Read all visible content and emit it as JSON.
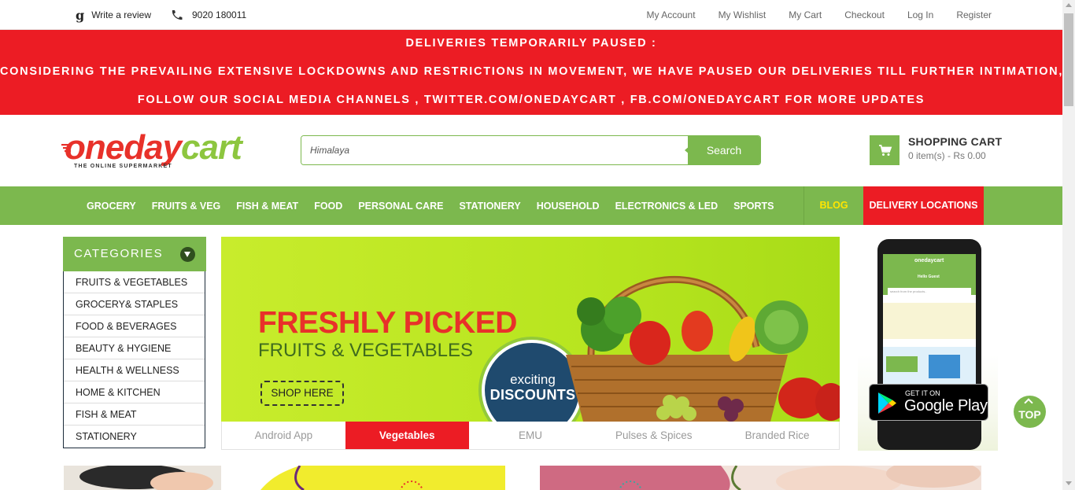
{
  "topbar": {
    "review_label": "Write a review",
    "phone": "9020 180011",
    "links": [
      "My Account",
      "My Wishlist",
      "My Cart",
      "Checkout",
      "Log In",
      "Register"
    ]
  },
  "notice": {
    "line1": "DELIVERIES TEMPORARILY PAUSED :",
    "line2": "CONSIDERING THE PREVAILING EXTENSIVE LOCKDOWNS AND RESTRICTIONS IN MOVEMENT, WE HAVE PAUSED OUR DELIVERIES TILL FURTHER INTIMATION, PLEASE",
    "line3": "FOLLOW OUR SOCIAL MEDIA CHANNELS , TWITTER.COM/ONEDAYCART , FB.COM/ONEDAYCART FOR MORE UPDATES"
  },
  "logo": {
    "part1": "oneday",
    "part2": "cart",
    "tagline": "THE ONLINE SUPERMARKET"
  },
  "search": {
    "value": "Himalaya",
    "button_label": "Search"
  },
  "cart": {
    "title": "SHOPPING CART",
    "summary": "0 item(s) - Rs 0.00"
  },
  "nav": {
    "items": [
      "GROCERY",
      "FRUITS & VEG",
      "FISH & MEAT",
      "FOOD",
      "PERSONAL CARE",
      "STATIONERY",
      "HOUSEHOLD",
      "ELECTRONICS & LED",
      "SPORTS"
    ],
    "blog": "BLOG",
    "delivery": "DELIVERY LOCATIONS"
  },
  "categories": {
    "title": "CATEGORIES",
    "items": [
      "FRUITS & VEGETABLES",
      "GROCERY& STAPLES",
      "FOOD & BEVERAGES",
      "BEAUTY & HYGIENE",
      "HEALTH & WELLNESS",
      "HOME & KITCHEN",
      "FISH & MEAT",
      "STATIONERY"
    ]
  },
  "banner": {
    "headline": "FRESHLY PICKED",
    "subhead": "FRUITS & VEGETABLES",
    "cta": "SHOP HERE",
    "badge_top": "exciting",
    "badge_bottom": "DISCOUNTS"
  },
  "tabs": {
    "items": [
      "Android App",
      "Vegetables",
      "EMU",
      "Pulses & Spices",
      "Branded Rice"
    ],
    "active": "Vegetables"
  },
  "phone_promo": {
    "app_name": "onedaycart",
    "greeting": "Hello Guest",
    "search_placeholder": "search from the products..",
    "store_small": "GET IT ON",
    "store_big": "Google Play"
  },
  "top_button": "TOP",
  "colors": {
    "brand_green": "#7cb84e",
    "brand_red": "#ec1c24",
    "blog_yellow": "#ffe600"
  }
}
